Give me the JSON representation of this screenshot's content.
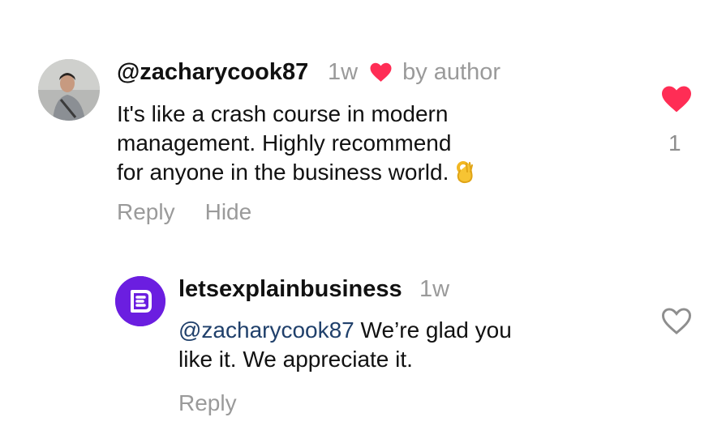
{
  "comment": {
    "username": "@zacharycook87",
    "time": "1w",
    "author_badge": "by author",
    "text_lines": [
      "It's like a crash course in modern",
      "management. Highly recommend",
      "for anyone in the business world."
    ],
    "emoji": "ok-hand-icon",
    "reply_label": "Reply",
    "hide_label": "Hide",
    "like_count": "1",
    "liked": true
  },
  "reply": {
    "username": "letsexplainbusiness",
    "time": "1w",
    "mention": "@zacharycook87",
    "text_line1": " We’re glad you",
    "text_line2": "like it. We appreciate it.",
    "reply_label": "Reply",
    "liked": false
  },
  "colors": {
    "like_red": "#ff2d55",
    "muted_gray": "#9a9a9a",
    "mention_blue": "#20406b",
    "brand_purple": "#6b1ee0"
  }
}
